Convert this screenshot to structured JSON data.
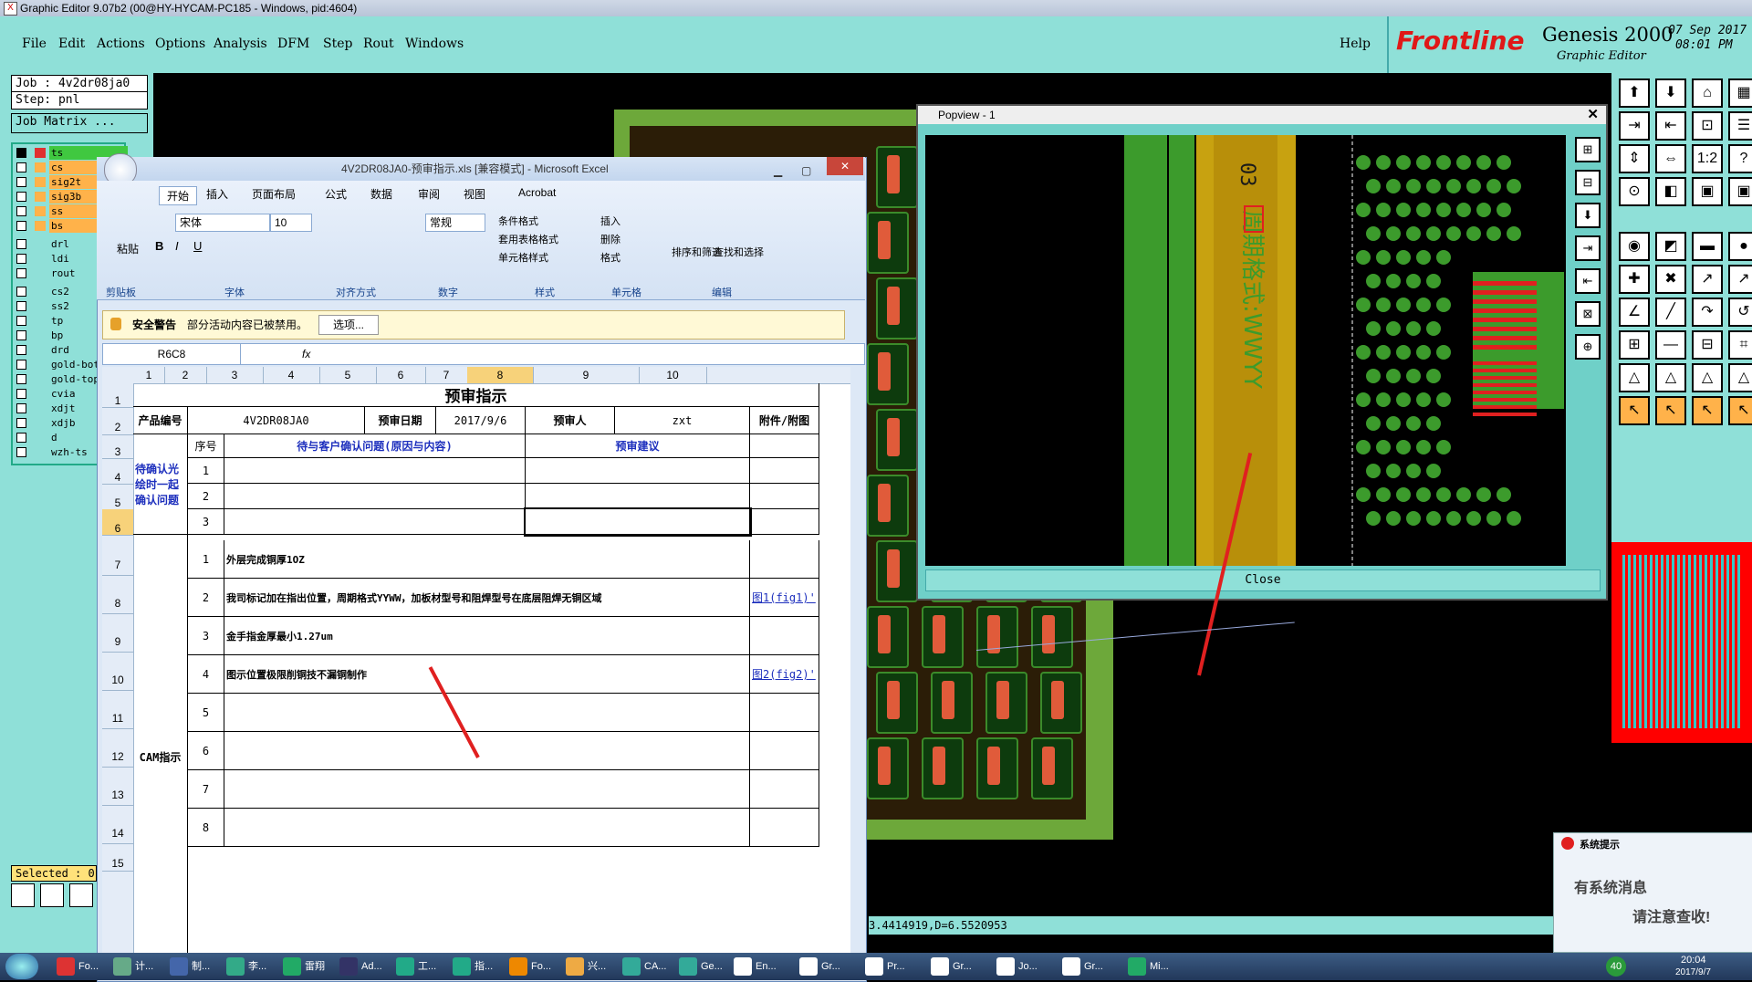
{
  "genesis": {
    "title": "Graphic Editor 9.07b2 (00@HY-HYCAM-PC185 - Windows, pid:4604)",
    "menu": [
      "File",
      "Edit",
      "Actions",
      "Options",
      "Analysis",
      "DFM",
      "Step",
      "Rout",
      "Windows"
    ],
    "help": "Help",
    "brand": "Frontline",
    "product": "Genesis 2000",
    "subtitle": "Graphic Editor",
    "date": "07 Sep 2017",
    "time": "08:01 PM",
    "job": "Job : 4v2dr08ja0",
    "step": "Step: pnl",
    "job_matrix": "Job Matrix ...",
    "layers": [
      {
        "name": "ts",
        "on": true,
        "color": "#e03030"
      },
      {
        "name": "cs",
        "on": false,
        "color": "#ffb24a"
      },
      {
        "name": "sig2t",
        "on": false,
        "color": "#ffb24a"
      },
      {
        "name": "sig3b",
        "on": false,
        "color": "#ffb24a"
      },
      {
        "name": "ss",
        "on": false,
        "color": "#ffb24a"
      },
      {
        "name": "bs",
        "on": false,
        "color": "#ffb24a"
      },
      {
        "name": "drl",
        "on": false,
        "color": ""
      },
      {
        "name": "ldi",
        "on": false,
        "color": ""
      },
      {
        "name": "rout",
        "on": false,
        "color": ""
      },
      {
        "name": "cs2",
        "on": false,
        "color": ""
      },
      {
        "name": "ss2",
        "on": false,
        "color": ""
      },
      {
        "name": "tp",
        "on": false,
        "color": ""
      },
      {
        "name": "bp",
        "on": false,
        "color": ""
      },
      {
        "name": "drd",
        "on": false,
        "color": ""
      },
      {
        "name": "gold-bot",
        "on": false,
        "color": ""
      },
      {
        "name": "gold-top",
        "on": false,
        "color": ""
      },
      {
        "name": "cvia",
        "on": false,
        "color": ""
      },
      {
        "name": "xdjt",
        "on": false,
        "color": ""
      },
      {
        "name": "xdjb",
        "on": false,
        "color": ""
      },
      {
        "name": "d",
        "on": false,
        "color": ""
      },
      {
        "name": "wzh-ts",
        "on": false,
        "color": ""
      }
    ],
    "selected": "Selected : 0",
    "status": "3.4414919,D=6.5520953"
  },
  "popview": {
    "title": "Popview - 1",
    "close": "Close",
    "silk_text": "周期格式:WWYY",
    "silk_top": "03"
  },
  "excel": {
    "title": "4V2DR08JA0-预审指示.xls  [兼容模式] - Microsoft Excel",
    "tabs": [
      "开始",
      "插入",
      "页面布局",
      "公式",
      "数据",
      "审阅",
      "视图",
      "Acrobat"
    ],
    "font": "宋体",
    "size": "10",
    "numfmt": "常规",
    "groups": [
      "剪贴板",
      "字体",
      "对齐方式",
      "数字",
      "样式",
      "单元格",
      "编辑"
    ],
    "paste": "粘贴",
    "style_items": [
      "条件格式",
      "套用表格格式",
      "单元格样式"
    ],
    "cell_items": [
      "插入",
      "删除",
      "格式"
    ],
    "edit_items": [
      "排序和筛选",
      "查找和选择"
    ],
    "security_title": "安全警告",
    "security_text": "部分活动内容已被禁用。",
    "security_btn": "选项...",
    "namebox": "R6C8",
    "fx": "fx",
    "col_headers": [
      "1",
      "2",
      "3",
      "4",
      "5",
      "6",
      "7",
      "8",
      "9",
      "10"
    ],
    "row_headers": [
      "1",
      "2",
      "3",
      "4",
      "5",
      "6",
      "7",
      "8",
      "9",
      "10",
      "11",
      "12",
      "13",
      "14",
      "15"
    ],
    "sheet": {
      "title": "预审指示",
      "product_no_label": "产品编号",
      "product_no": "4V2DR08JA0",
      "date_label": "预审日期",
      "date": "2017/9/6",
      "reviewer_label": "预审人",
      "reviewer": "zxt",
      "attach_label": "附件/附图",
      "seq_label": "序号",
      "issue_label": "待与客户确认问题(原因与内容)",
      "suggest_label": "预审建议",
      "group1": "待确认光绘时一起确认问题",
      "group2": "CAM指示",
      "seq1": [
        "1",
        "2",
        "3"
      ],
      "seq2": [
        "1",
        "2",
        "3",
        "4",
        "5",
        "6",
        "7",
        "8"
      ],
      "items": [
        "外层完成铜厚1OZ",
        "我司标记加在指出位置，周期格式YYWW，加板材型号和阻焊型号在底层阻焊无铜区域",
        "金手指金厚最小1.27um",
        "图示位置极限削铜技不漏铜制作"
      ],
      "links": [
        "图1(fig1)'",
        "图2(fig2)'"
      ]
    }
  },
  "notice": {
    "title": "系统提示",
    "line1": "有系统消息",
    "line2": "请注意查收!"
  },
  "taskbar": {
    "items": [
      "Fo...",
      "计...",
      "制...",
      "李...",
      "雷翔",
      "Ad...",
      "工...",
      "指...",
      "Fo...",
      "兴...",
      "CA...",
      "Ge...",
      "En...",
      "Gr...",
      "Pr...",
      "Gr...",
      "Jo...",
      "Gr...",
      "Mi..."
    ],
    "clock_time": "20:04",
    "clock_date": "2017/9/7",
    "badge": "40"
  }
}
